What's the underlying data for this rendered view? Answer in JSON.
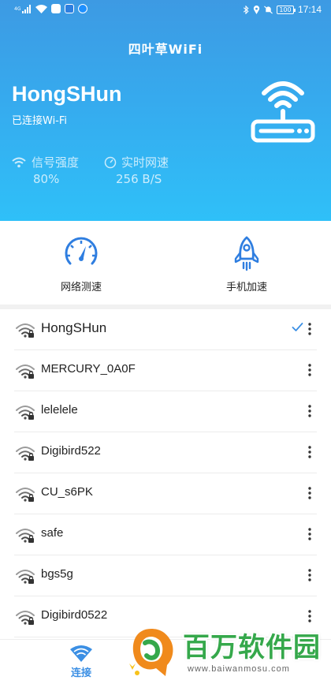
{
  "status_bar": {
    "left_icons": [
      "sim-signal-icon",
      "wifi-icon",
      "message-icon",
      "app-icon-blue",
      "app-icon-blue-2"
    ],
    "right_icons": [
      "bluetooth-icon",
      "location-icon",
      "silent-icon"
    ],
    "battery": "100",
    "time": "17:14"
  },
  "header": {
    "title": "四叶草WiFi",
    "ssid": "HongSHun",
    "status": "已连接Wi-Fi",
    "signal_label": "信号强度",
    "signal_value": "80%",
    "signal_strength": 0.8,
    "speed_label": "实时网速",
    "speed_value": "256 B/S"
  },
  "actions": [
    {
      "label": "网络测速",
      "icon": "speedometer-icon"
    },
    {
      "label": "手机加速",
      "icon": "rocket-icon"
    }
  ],
  "networks": [
    {
      "name": "HongSHun",
      "current": true
    },
    {
      "name": "MERCURY_0A0F",
      "current": false
    },
    {
      "name": "lelelele",
      "current": false
    },
    {
      "name": "Digibird522",
      "current": false
    },
    {
      "name": "CU_s6PK",
      "current": false
    },
    {
      "name": "safe",
      "current": false
    },
    {
      "name": "bgs5g",
      "current": false
    },
    {
      "name": "Digibird0522",
      "current": false
    }
  ],
  "bottom_nav": {
    "tabs": [
      {
        "label": "连接",
        "icon": "wifi-icon",
        "active": true
      }
    ]
  },
  "watermark": {
    "text": "百万软件园",
    "url": "www.baiwanmosu.com"
  },
  "colors": {
    "header_gradient_top": "#3d9ae3",
    "header_gradient_bottom": "#2fc0f8",
    "accent_blue": "#3b8fe4",
    "check_blue": "#3b8fe4",
    "watermark_green": "#35a84b"
  }
}
